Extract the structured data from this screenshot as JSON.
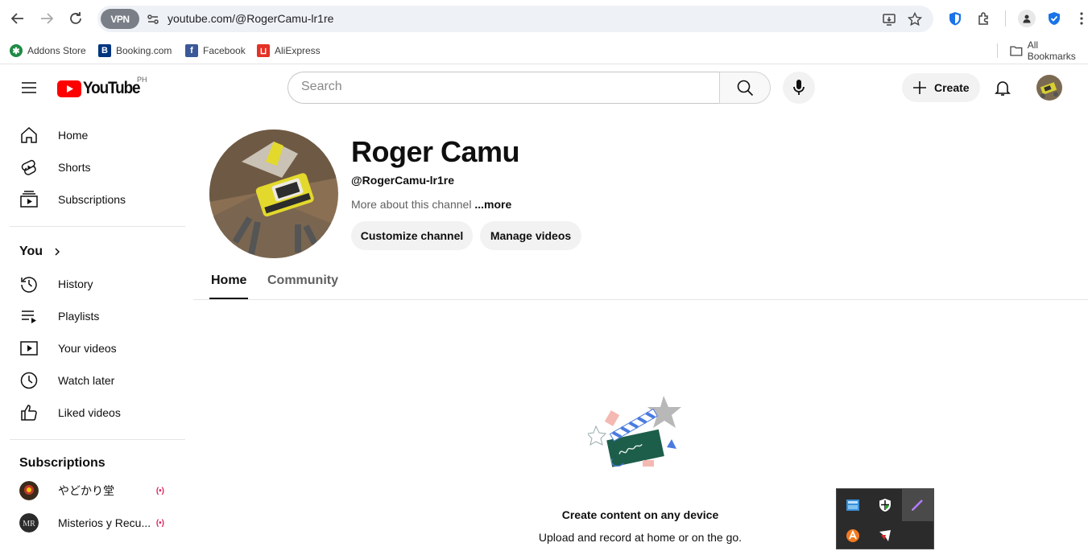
{
  "browser": {
    "url": "youtube.com/@RogerCamu-lr1re",
    "vpn_label": "VPN",
    "bookmarks": [
      {
        "label": "Addons Store",
        "icon": "addons-store-icon"
      },
      {
        "label": "Booking.com",
        "icon": "booking-icon"
      },
      {
        "label": "Facebook",
        "icon": "facebook-icon"
      },
      {
        "label": "AliExpress",
        "icon": "aliexpress-icon"
      }
    ],
    "all_bookmarks_label": "All Bookmarks"
  },
  "header": {
    "logo_text": "YouTube",
    "country_code": "PH",
    "search_placeholder": "Search",
    "create_label": "Create"
  },
  "sidebar": {
    "main": [
      {
        "label": "Home",
        "icon": "home-icon"
      },
      {
        "label": "Shorts",
        "icon": "shorts-icon"
      },
      {
        "label": "Subscriptions",
        "icon": "subscriptions-icon"
      }
    ],
    "you_heading": "You",
    "you": [
      {
        "label": "History",
        "icon": "history-icon"
      },
      {
        "label": "Playlists",
        "icon": "playlists-icon"
      },
      {
        "label": "Your videos",
        "icon": "your-videos-icon"
      },
      {
        "label": "Watch later",
        "icon": "watch-later-icon"
      },
      {
        "label": "Liked videos",
        "icon": "liked-videos-icon"
      }
    ],
    "subscriptions_heading": "Subscriptions",
    "subscriptions": [
      {
        "label": "やどかり堂",
        "live": "(•)"
      },
      {
        "label": "Misterios y Recu...",
        "live": "(•)"
      }
    ]
  },
  "channel": {
    "name": "Roger Camu",
    "handle": "@RogerCamu-lr1re",
    "about": "More about this channel",
    "more": "...more",
    "customize_label": "Customize channel",
    "manage_label": "Manage videos",
    "tabs": [
      "Home",
      "Community"
    ],
    "active_tab": "Home",
    "empty_title": "Create content on any device",
    "empty_desc": "Upload and record at home or on the go."
  },
  "colors": {
    "youtube_red": "#ff0000",
    "accent_blue": "#1a73e8"
  }
}
